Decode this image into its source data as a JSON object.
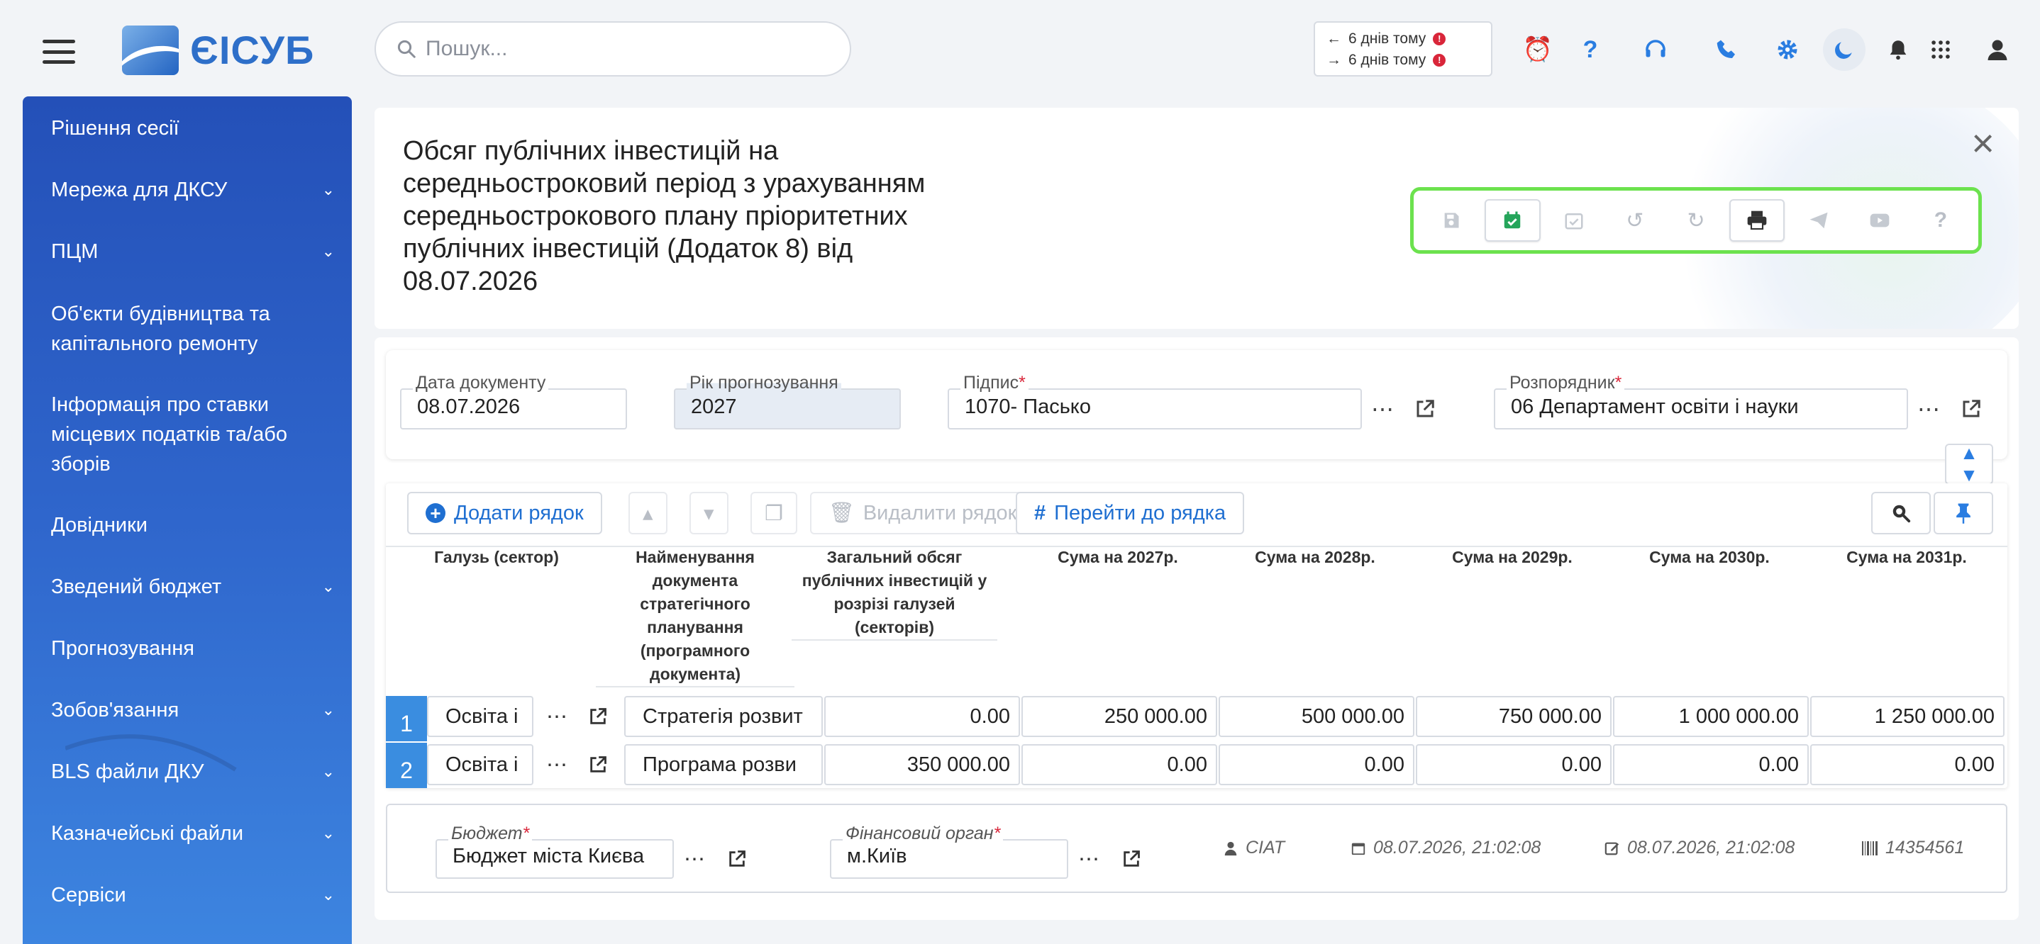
{
  "header": {
    "logo_text": "ЄІСУБ",
    "search_placeholder": "Пошук...",
    "history": [
      {
        "arrow": "←",
        "label": "6 днів тому",
        "badge": "!"
      },
      {
        "arrow": "→",
        "label": "6 днів тому",
        "badge": "!"
      }
    ],
    "icons": [
      "alarm-clock-icon",
      "help-icon",
      "support-headset-icon",
      "phone-icon",
      "settings-gear-icon",
      "dark-mode-moon-icon",
      "bell-icon",
      "apps-grid-icon",
      "user-icon"
    ]
  },
  "sidebar": {
    "items": [
      {
        "label": "Рішення сесії",
        "has_children": false
      },
      {
        "label": "Мережа для ДКСУ",
        "has_children": true
      },
      {
        "label": "ПЦМ",
        "has_children": true
      },
      {
        "label": "Об'єкти будівництва та капітального ремонту",
        "has_children": false
      },
      {
        "label": "Інформація про ставки місцевих податків та/або зборів",
        "has_children": false
      },
      {
        "label": "Довідники",
        "has_children": false
      },
      {
        "label": "Зведений бюджет",
        "has_children": true
      },
      {
        "label": "Прогнозування",
        "has_children": false
      },
      {
        "label": "Зобов'язання",
        "has_children": true
      },
      {
        "label": "BLS файли ДКУ",
        "has_children": true
      },
      {
        "label": "Казначейські файли",
        "has_children": true
      },
      {
        "label": "Сервіси",
        "has_children": true
      }
    ]
  },
  "document": {
    "title": "Обсяг публічних інвестицій на середньостроковий період з урахуванням середньострокового плану пріоритетних публічних інвестицій (Додаток 8) від 08.07.2026"
  },
  "toolbar": {
    "buttons": [
      "save-icon",
      "calendar-check-icon",
      "calendar-check-outline-icon",
      "undo-icon",
      "redo-icon",
      "print-icon",
      "send-icon",
      "video-icon",
      "help-icon"
    ]
  },
  "form": {
    "doc_date_label": "Дата документу",
    "doc_date_value": "08.07.2026",
    "forecast_year_label": "Рік прогнозування",
    "forecast_year_value": "2027",
    "signature_label": "Підпис",
    "signature_value": "1070- Пасько",
    "manager_label": "Розпорядник",
    "manager_value": "06 Департамент освіти і науки",
    "required_mark": "*"
  },
  "table": {
    "add_row": "Додати рядок",
    "delete_row": "Видалити рядок",
    "goto_row": "Перейти до рядка",
    "columns": [
      "Галузь (сектор)",
      "Найменування документа стратегічного планування (програмного документа)",
      "Загальний обсяг публічних інвестицій у розрізі галузей (секторів)",
      "Сума на 2027р.",
      "Сума на 2028р.",
      "Сума на 2029р.",
      "Сума на 2030р.",
      "Сума на 2031р."
    ],
    "rows": [
      {
        "num": "1",
        "sector": "Освіта і",
        "doc": "Стратегія розвит",
        "total": "0.00",
        "y2027": "250 000.00",
        "y2028": "500 000.00",
        "y2029": "750 000.00",
        "y2030": "1 000 000.00",
        "y2031": "1 250 000.00"
      },
      {
        "num": "2",
        "sector": "Освіта і",
        "doc": "Програма розви",
        "total": "350 000.00",
        "y2027": "0.00",
        "y2028": "0.00",
        "y2029": "0.00",
        "y2030": "0.00",
        "y2031": "0.00"
      }
    ]
  },
  "footer": {
    "budget_label": "Бюджет",
    "budget_value": "Бюджет міста Києва",
    "fin_label": "Фінансовий орган",
    "fin_value": "м.Київ",
    "user": "CIAT",
    "created": "08.07.2026, 21:02:08",
    "modified": "08.07.2026, 21:02:08",
    "doc_id": "14354561"
  }
}
